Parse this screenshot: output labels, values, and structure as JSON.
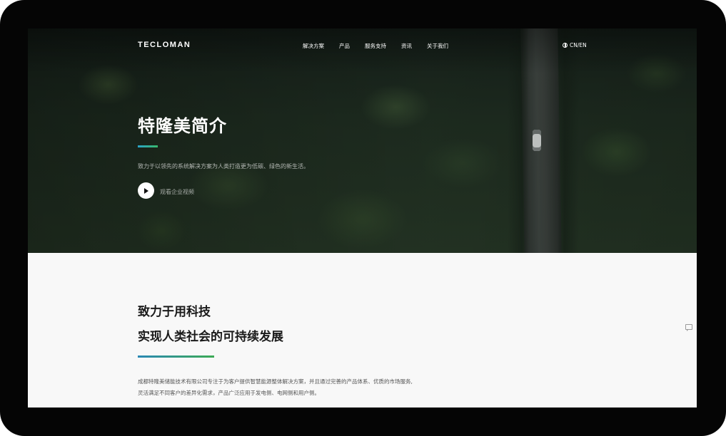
{
  "header": {
    "logo": "TECLOMAN",
    "nav": [
      "解决方案",
      "产品",
      "服务支持",
      "资讯",
      "关于我们"
    ],
    "language": "CN/EN"
  },
  "hero": {
    "title": "特隆美简介",
    "subtitle": "致力于以领先的系统解决方案为人类打造更为低碳、绿色的新生活。",
    "video_label": "观看企业视频",
    "accent_colors": [
      "#2aa4c9",
      "#39b86b"
    ]
  },
  "intro": {
    "heading_line1": "致力于用科技",
    "heading_line2": "实现人类社会的可持续发展",
    "paragraph_line1": "成都特隆美储能技术有限公司专注于为客户提供智慧能源整体解决方案，并且通过完善的产品体系、优质的市场服务,",
    "paragraph_line2": "灵活满足不同客户的差异化需求，产品广泛应用于发电侧、电网侧和用户侧。"
  },
  "icons": {
    "globe": "globe-icon",
    "play": "play-icon",
    "chat": "chat-icon"
  }
}
